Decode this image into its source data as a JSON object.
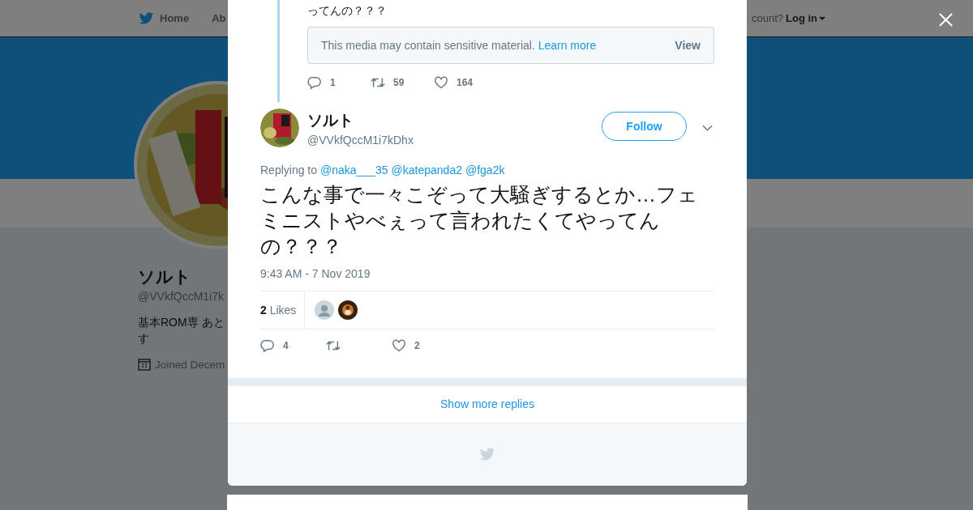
{
  "background_page": {
    "nav": {
      "items": [
        {
          "label": "Home"
        },
        {
          "label": "Ab"
        }
      ],
      "login_prompt": "count?",
      "login": "Log in"
    },
    "profile": {
      "name": "ソルト",
      "handle": "@VVkfQccM1i7k",
      "bio_lines": [
        "基本ROM専 あと",
        "す"
      ],
      "joined": "Joined Decem"
    }
  },
  "modal": {
    "previous_tweet": {
      "text_tail": "ってんの？？？",
      "sensitive_notice": "This media may contain sensitive material.",
      "learn_more": "Learn more",
      "view": "View",
      "actions": [
        {
          "kind": "reply",
          "count": "1"
        },
        {
          "kind": "retweet",
          "count": "59"
        },
        {
          "kind": "like",
          "count": "164"
        }
      ]
    },
    "tweet": {
      "name": "ソルト",
      "handle": "@VVkfQccM1i7kDhx",
      "follow": "Follow",
      "replying_label": "Replying to",
      "replying_to": [
        "@naka___35",
        "@katepanda2",
        "@fga2k"
      ],
      "text": "こんな事で一々こぞって大騒ぎするとか…フェミニストやべぇって言われたくてやってんの？？？",
      "time": "9:43 AM - 7 Nov 2019",
      "likes_count": "2",
      "likes_label": "Likes",
      "likers": [
        {
          "kind": "default"
        },
        {
          "kind": "picture"
        }
      ],
      "actions": [
        {
          "kind": "reply",
          "count": "4"
        },
        {
          "kind": "retweet"
        },
        {
          "kind": "like",
          "count": "2"
        }
      ]
    },
    "show_more": "Show more replies"
  }
}
